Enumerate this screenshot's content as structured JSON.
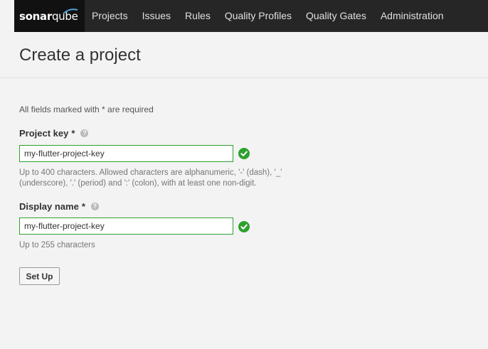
{
  "nav": {
    "logo_sonar": "sonar",
    "logo_qube": "qube",
    "items": [
      {
        "label": "Projects"
      },
      {
        "label": "Issues"
      },
      {
        "label": "Rules"
      },
      {
        "label": "Quality Profiles"
      },
      {
        "label": "Quality Gates"
      },
      {
        "label": "Administration"
      }
    ]
  },
  "page": {
    "title": "Create a project",
    "required_note": "All fields marked with * are required"
  },
  "form": {
    "project_key": {
      "label": "Project key",
      "required_mark": "*",
      "value": "my-flutter-project-key",
      "hint_line1": "Up to 400 characters. Allowed characters are alphanumeric, '-' (dash), '_'",
      "hint_line2": "(underscore), '.' (period) and ':' (colon), with at least one non-digit."
    },
    "display_name": {
      "label": "Display name",
      "required_mark": "*",
      "value": "my-flutter-project-key",
      "hint": "Up to 255 characters"
    },
    "submit_label": "Set Up"
  },
  "colors": {
    "topbar": "#262626",
    "valid_green": "#2ea02e",
    "background": "#f3f3f3"
  },
  "icons": {
    "help": "question-circle-icon",
    "valid": "check-circle-icon"
  }
}
